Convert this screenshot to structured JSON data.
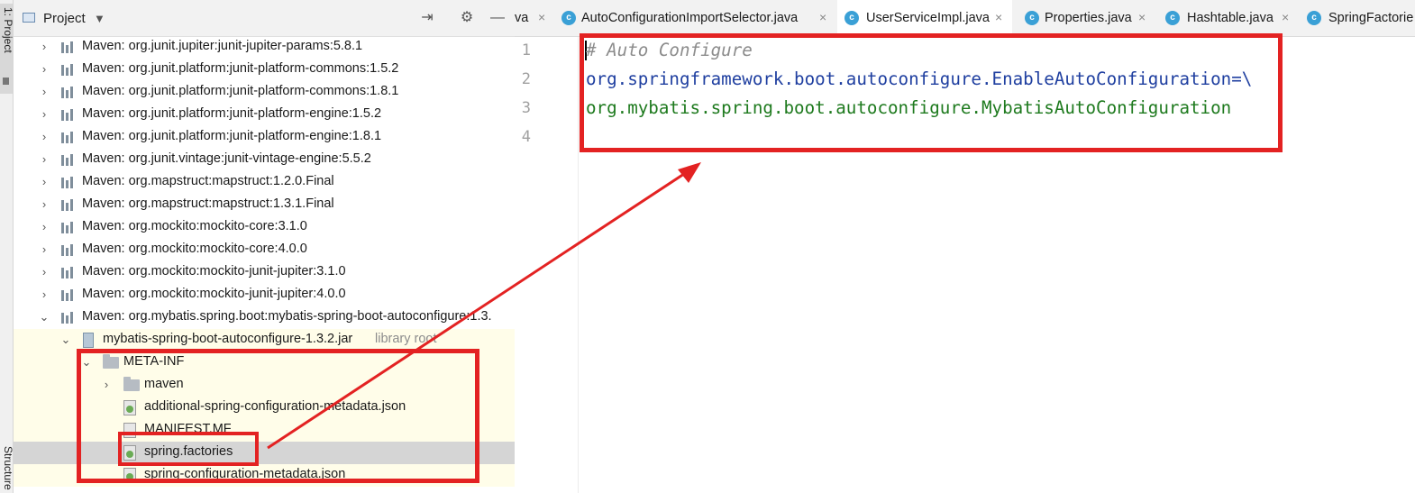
{
  "stripe": {
    "top_label": "1: Project",
    "bottom_label": "Structure"
  },
  "project_panel": {
    "title": "Project",
    "tree": [
      {
        "label": "Maven: org.junit.jupiter:junit-jupiter-params:5.8.1"
      },
      {
        "label": "Maven: org.junit.platform:junit-platform-commons:1.5.2"
      },
      {
        "label": "Maven: org.junit.platform:junit-platform-commons:1.8.1"
      },
      {
        "label": "Maven: org.junit.platform:junit-platform-engine:1.5.2"
      },
      {
        "label": "Maven: org.junit.platform:junit-platform-engine:1.8.1"
      },
      {
        "label": "Maven: org.junit.vintage:junit-vintage-engine:5.5.2"
      },
      {
        "label": "Maven: org.mapstruct:mapstruct:1.2.0.Final"
      },
      {
        "label": "Maven: org.mapstruct:mapstruct:1.3.1.Final"
      },
      {
        "label": "Maven: org.mockito:mockito-core:3.1.0"
      },
      {
        "label": "Maven: org.mockito:mockito-core:4.0.0"
      },
      {
        "label": "Maven: org.mockito:mockito-junit-jupiter:3.1.0"
      },
      {
        "label": "Maven: org.mockito:mockito-junit-jupiter:4.0.0"
      },
      {
        "label": "Maven: org.mybatis.spring.boot:mybatis-spring-boot-autoconfigure:1.3."
      }
    ],
    "jar": {
      "label": "mybatis-spring-boot-autoconfigure-1.3.2.jar",
      "suffix": "library root"
    },
    "meta_inf": "META-INF",
    "children": [
      {
        "label": "maven"
      },
      {
        "label": "additional-spring-configuration-metadata.json"
      },
      {
        "label": "MANIFEST.MF"
      },
      {
        "label": "spring.factories"
      },
      {
        "label": "spring-configuration-metadata.json"
      }
    ]
  },
  "editor": {
    "tabs": [
      {
        "label": "va",
        "closable": true
      },
      {
        "label": "AutoConfigurationImportSelector.java",
        "closable": true
      },
      {
        "label": "UserServiceImpl.java",
        "closable": true,
        "active": true
      },
      {
        "label": "Properties.java",
        "closable": true
      },
      {
        "label": "Hashtable.java",
        "closable": true
      },
      {
        "label": "SpringFactorie"
      }
    ],
    "line_numbers": [
      "1",
      "2",
      "3",
      "4"
    ],
    "lines": [
      "# Auto Configure",
      "org.springframework.boot.autoconfigure.EnableAutoConfiguration=\\",
      "org.mybatis.spring.boot.autoconfigure.MybatisAutoConfiguration",
      ""
    ]
  },
  "colors": {
    "annotation": "#e32222",
    "selection": "#d5d5d5",
    "library_bg": "#fffde9"
  }
}
